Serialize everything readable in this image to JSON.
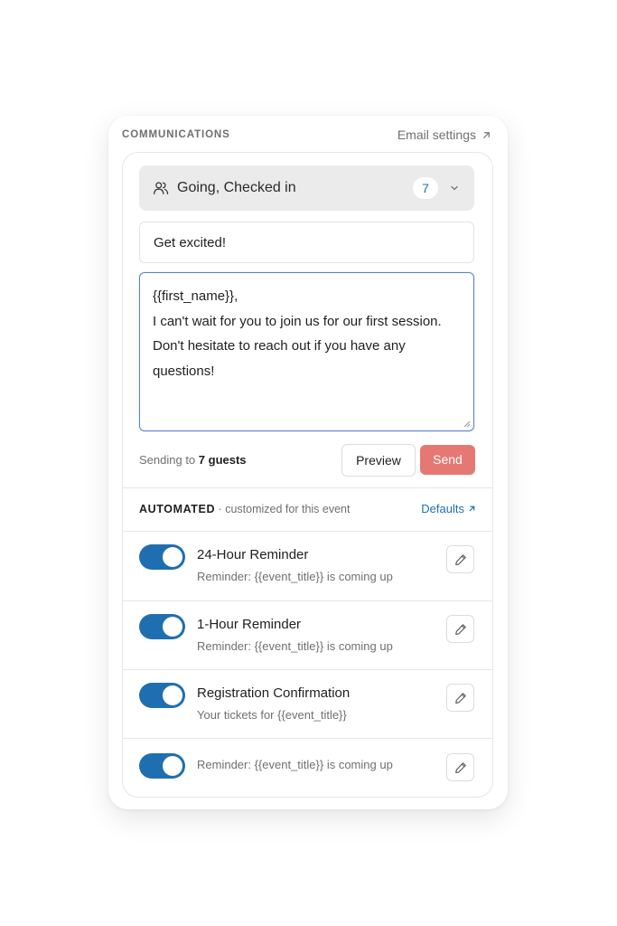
{
  "header": {
    "title": "COMMUNICATIONS",
    "settings_link": "Email settings"
  },
  "compose": {
    "recipients_label": "Going, Checked in",
    "recipients_count": "7",
    "subject": "Get excited!",
    "body_lines": [
      "{{first_name}},",
      "",
      "I can't wait for you to join us for our first session.",
      "Don't hesitate to reach out if you have any",
      "questions!"
    ],
    "sending_prefix": "Sending to",
    "sending_count": "7 guests",
    "preview_label": "Preview",
    "send_label": "Send"
  },
  "automated": {
    "title": "AUTOMATED",
    "subtitle": "· customized for this event",
    "defaults_link": "Defaults",
    "items": [
      {
        "title": "24-Hour Reminder",
        "subtitle": "Reminder: {{event_title}} is coming up",
        "enabled": true
      },
      {
        "title": "1-Hour Reminder",
        "subtitle": "Reminder: {{event_title}} is coming up",
        "enabled": true
      },
      {
        "title": "Registration Confirmation",
        "subtitle": "Your tickets for {{event_title}}",
        "enabled": true
      },
      {
        "title": "",
        "subtitle": "Reminder: {{event_title}} is coming up",
        "enabled": true
      }
    ]
  },
  "colors": {
    "accent_blue": "#1f6fb0",
    "send_button": "#e57872",
    "focus_border": "#5b82cc",
    "recipient_bg": "#ebebeb"
  },
  "icons": {
    "recipients": "users-icon",
    "dropdown": "chevron-down-icon",
    "external": "arrow-up-right-icon",
    "edit": "pencil-icon"
  }
}
